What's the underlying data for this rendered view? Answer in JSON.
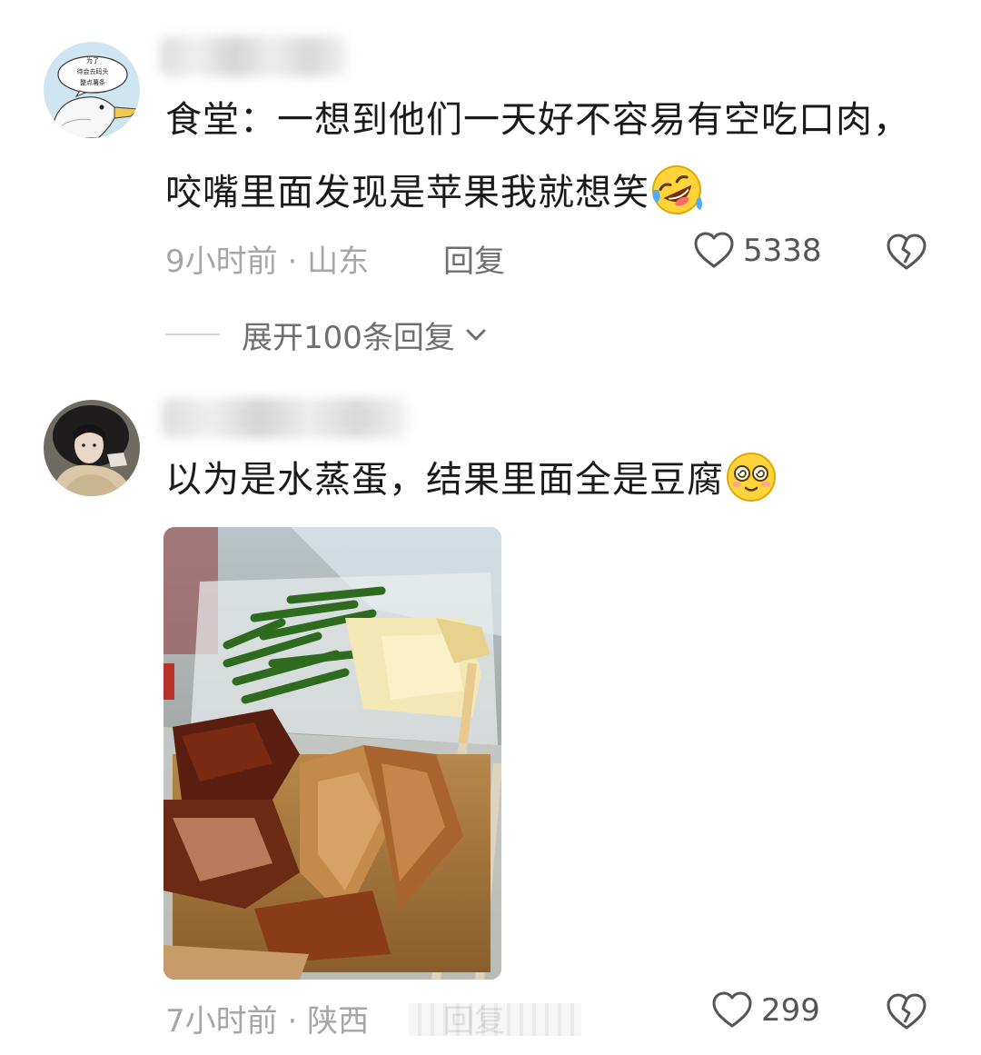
{
  "comments": [
    {
      "text": "食堂：一想到他们一天好不容易有空吃口肉，咬嘴里面发现是苹果我就想笑",
      "avatar_text": [
        "为了",
        "待会去码头",
        "整点薯条"
      ],
      "emoji": "rofl-emoji",
      "time": "9小时前",
      "location": "山东",
      "reply_label": "回复",
      "likes": "5338"
    },
    {
      "text": "以为是水蒸蛋，结果里面全是豆腐",
      "emoji": "dizzy-eyes-emoji",
      "time": "7小时前",
      "location": "陕西",
      "reply_label": "回复",
      "likes": "299"
    }
  ],
  "expand_replies": "展开100条回复",
  "separator": "·",
  "icons": {
    "like": "heart-outline-icon",
    "dislike": "broken-heart-icon",
    "expand": "chevron-down-icon"
  },
  "colors": {
    "text": "#1a1a1a",
    "meta": "#a6a6a6",
    "reply": "#6f6f6f"
  }
}
